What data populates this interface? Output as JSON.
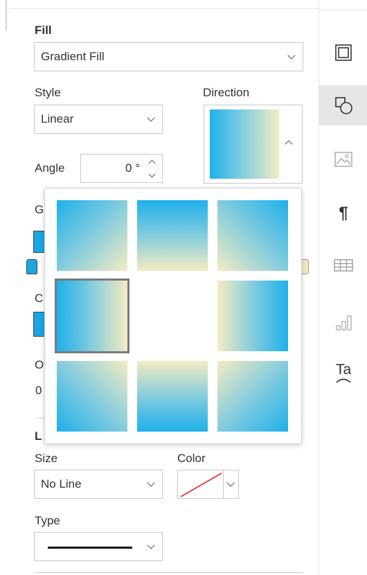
{
  "fill": {
    "label": "Fill",
    "value": "Gradient Fill"
  },
  "style": {
    "label": "Style",
    "value": "Linear"
  },
  "direction": {
    "label": "Direction"
  },
  "angle": {
    "label": "Angle",
    "value": "0 °"
  },
  "line": {
    "size_label": "Size",
    "size_value": "No Line",
    "color_label": "Color",
    "type_label": "Type"
  },
  "partial_labels": {
    "g": "G",
    "c": "C",
    "o": "O",
    "zero": "0",
    "l": "L"
  },
  "gradient": {
    "start_color": "#1eb0ea",
    "end_color": "#f4ecc2"
  },
  "direction_options": [
    {
      "name": "from-top-left"
    },
    {
      "name": "from-top"
    },
    {
      "name": "from-top-right"
    },
    {
      "name": "from-left"
    },
    {
      "name": "from-right"
    },
    {
      "name": "from-bottom-left"
    },
    {
      "name": "from-bottom"
    },
    {
      "name": "from-bottom-right"
    }
  ],
  "selected_direction": "from-left",
  "rail_icons": [
    "shape-outline-icon",
    "shape-effects-icon",
    "image-icon",
    "paragraph-icon",
    "table-icon",
    "chart-icon",
    "text-art-icon"
  ],
  "active_rail_icon": "shape-effects-icon"
}
